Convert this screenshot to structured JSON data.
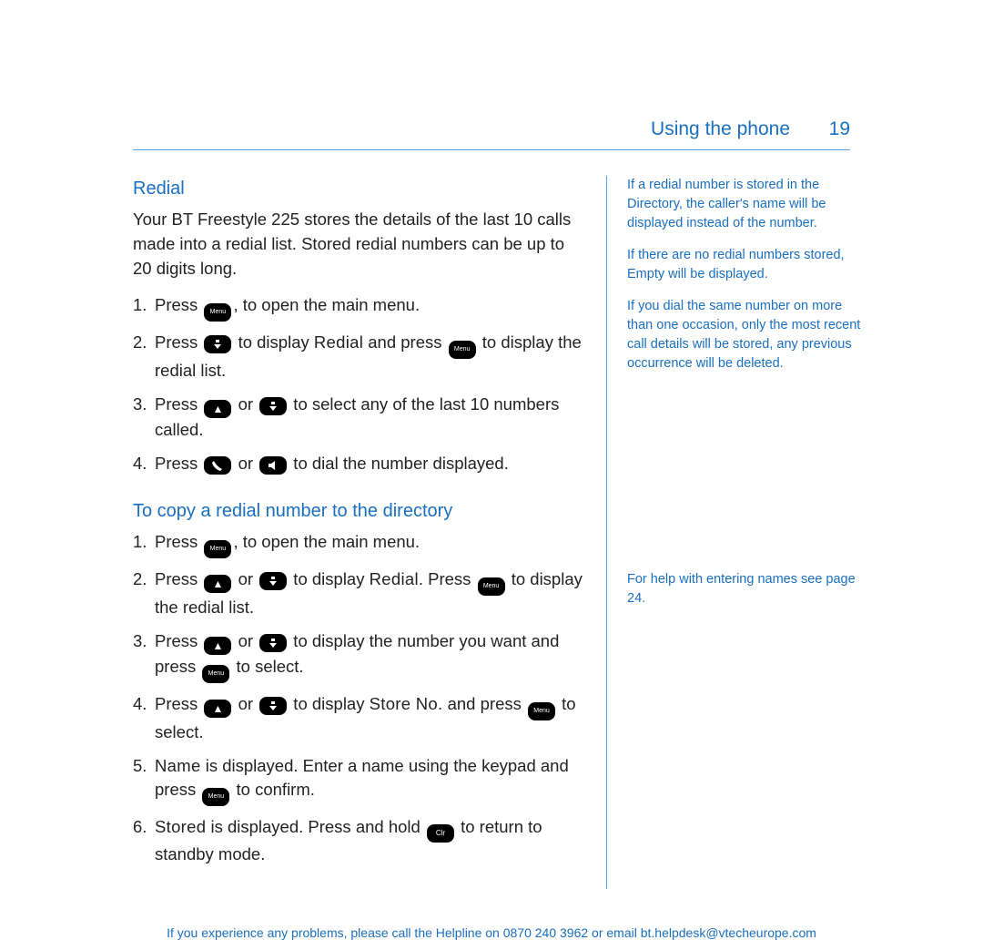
{
  "header": {
    "section_title": "Using the phone",
    "page_number": "19"
  },
  "sectionA": {
    "heading": "Redial",
    "intro": "Your BT Freestyle 225 stores the details of the last 10 calls made into a redial list. Stored redial numbers can be up to 20 digits long.",
    "steps": [
      {
        "n": "1.",
        "parts": [
          "Press ",
          {
            "key": "menu"
          },
          ", to open the main menu."
        ]
      },
      {
        "n": "2.",
        "parts": [
          "Press ",
          {
            "key": "down"
          },
          " to display ",
          {
            "scr": "Redial"
          },
          " and press ",
          {
            "key": "menu"
          },
          " to display the redial list."
        ]
      },
      {
        "n": "3.",
        "parts": [
          "Press ",
          {
            "key": "up"
          },
          " or ",
          {
            "key": "down"
          },
          " to select any of the last 10 numbers called."
        ]
      },
      {
        "n": "4.",
        "parts": [
          "Press ",
          {
            "key": "call"
          },
          " or ",
          {
            "key": "speaker"
          },
          " to dial the number displayed."
        ]
      }
    ]
  },
  "sectionB": {
    "heading": "To copy a redial number to the directory",
    "steps": [
      {
        "n": "1.",
        "parts": [
          "Press ",
          {
            "key": "menu"
          },
          ", to open the main menu."
        ]
      },
      {
        "n": "2.",
        "parts": [
          "Press ",
          {
            "key": "up"
          },
          " or ",
          {
            "key": "down"
          },
          " to display ",
          {
            "scr": "Redial"
          },
          ". Press ",
          {
            "key": "menu"
          },
          " to display the redial list."
        ]
      },
      {
        "n": "3.",
        "parts": [
          "Press ",
          {
            "key": "up"
          },
          " or ",
          {
            "key": "down"
          },
          " to display the number you want and press ",
          {
            "key": "menu"
          },
          " to select."
        ]
      },
      {
        "n": "4.",
        "parts": [
          "Press ",
          {
            "key": "up"
          },
          " or ",
          {
            "key": "down"
          },
          " to display ",
          {
            "scr": "Store No."
          },
          " and press ",
          {
            "key": "menu"
          },
          " to select."
        ]
      },
      {
        "n": "5.",
        "parts": [
          {
            "scr": "Name"
          },
          " is displayed. Enter a name using the keypad and press ",
          {
            "key": "menu"
          },
          " to confirm."
        ]
      },
      {
        "n": "6.",
        "parts": [
          {
            "scr": "Stored"
          },
          " is displayed. Press and hold ",
          {
            "key": "clr"
          },
          " to return to standby mode."
        ]
      }
    ]
  },
  "sidebar": {
    "notes": [
      "If a redial number is stored in the Directory, the caller's name will be displayed instead of the number.",
      "If there are no redial numbers stored, Empty will be displayed.",
      "If you dial the same number on more than one occasion, only the most recent call details will be stored, any previous occurrence will be deleted."
    ],
    "name_help": "For help with entering names see page 24."
  },
  "footer": "If you experience any problems, please call the Helpline on 0870 240 3962 or email bt.helpdesk@vtecheurope.com",
  "keys": {
    "menu": "Menu",
    "clr": "Clr"
  }
}
